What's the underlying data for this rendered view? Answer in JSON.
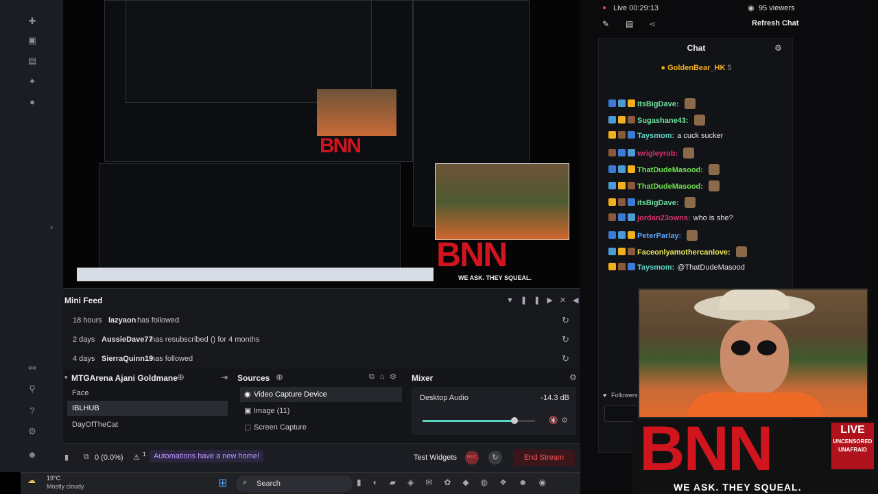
{
  "stream": {
    "live_label": "Live 00:29:13",
    "viewers": "95 viewers",
    "refresh_chat": "Refresh Chat"
  },
  "chat": {
    "title": "Chat",
    "pinned_user": "GoldenBear_HK",
    "pinned_count": "5",
    "messages": [
      {
        "user": "itsBigDave:",
        "text": "",
        "color": "#6fe0a0"
      },
      {
        "user": "Sugashane43:",
        "text": "",
        "color": "#6fe0a0"
      },
      {
        "user": "Taysmom:",
        "text": "a cuck sucker",
        "color": "#5fd3c3"
      },
      {
        "user": "wrigleyrob:",
        "text": "",
        "color": "#d6336c"
      },
      {
        "user": "ThatDudeMasood:",
        "text": "",
        "color": "#6fe04f"
      },
      {
        "user": "ThatDudeMasood:",
        "text": "",
        "color": "#6fe04f"
      },
      {
        "user": "itsBigDave:",
        "text": "",
        "color": "#6fe0a0"
      },
      {
        "user": "jordan23owns:",
        "text": "who is she?",
        "color": "#d6336c"
      },
      {
        "user": "PeterParlay:",
        "text": "",
        "color": "#5ea3ff"
      },
      {
        "user": "Faceonlyamothercanlove:",
        "text": "",
        "color": "#e8e85a"
      },
      {
        "user": "Taysmom:",
        "text": "@ThatDudeMasood",
        "color": "#5fd3c3"
      }
    ],
    "followers_label": "Followers"
  },
  "mini_feed": {
    "title": "Mini Feed",
    "rows": [
      {
        "when": "18 hours",
        "who": "lazyaon",
        "what": "has followed"
      },
      {
        "when": "2 days",
        "who": "AussieDave77",
        "what": "has resubscribed () for 4 months"
      },
      {
        "when": "4 days",
        "who": "SierraQuinn19",
        "what": "has followed"
      }
    ]
  },
  "scenes": {
    "title": "MTGArena Ajani Goldmane",
    "items": [
      "Face",
      "IBLHUB",
      "DayOfTheCat"
    ],
    "selected": 1
  },
  "sources": {
    "title": "Sources",
    "items": [
      "Video Capture Device",
      "Image (11)",
      "Screen Capture"
    ]
  },
  "mixer": {
    "title": "Mixer",
    "channel": "Desktop Audio",
    "level": "-14.3 dB",
    "volume_fraction": 0.82
  },
  "footer": {
    "stats": "0 (0.0%)",
    "warning_count": "1",
    "automations": "Automations have a new home!",
    "test_widgets": "Test Widgets",
    "end_stream": "End Stream",
    "rec": "REC"
  },
  "taskbar": {
    "temp": "19°C",
    "weather": "Mostly cloudy",
    "search": "Search"
  },
  "overlay": {
    "brand": "BNN",
    "live": "LIVE",
    "uncensored": "UNCENSORED",
    "unafraid": "UNAFRAID",
    "tagline": "WE ASK. THEY SQUEAL."
  },
  "colors": {
    "accent": "#5fd3c3",
    "danger": "#d0151f",
    "live_dot": "#e8424a"
  }
}
